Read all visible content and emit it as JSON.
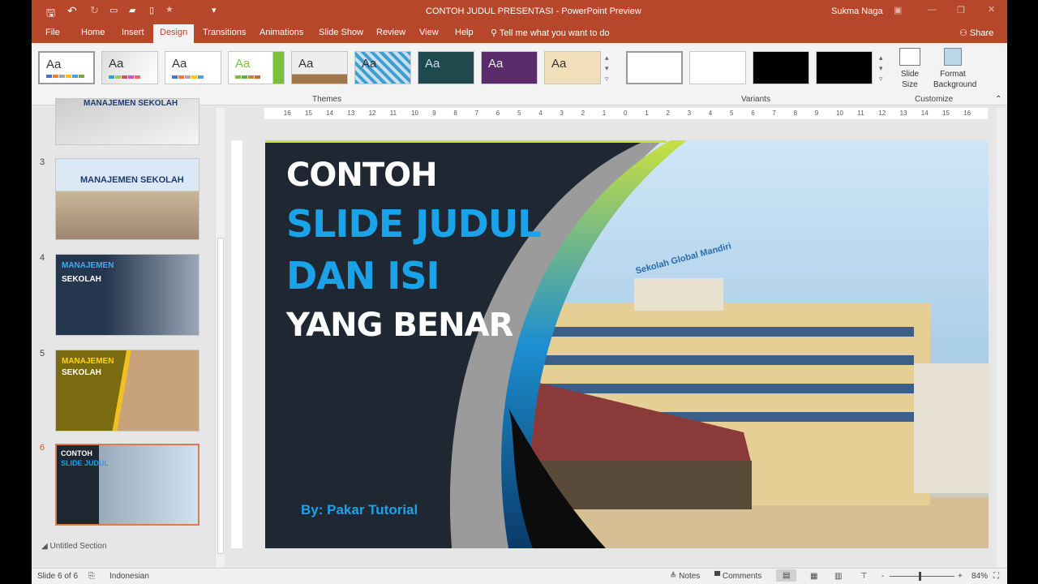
{
  "titlebar": {
    "title": "CONTOH JUDUL PRESENTASI  -  PowerPoint Preview",
    "user": "Sukma Naga"
  },
  "tabs": [
    "File",
    "Home",
    "Insert",
    "Design",
    "Transitions",
    "Animations",
    "Slide Show",
    "Review",
    "View",
    "Help"
  ],
  "active_tab": "Design",
  "tell_me": "Tell me what you want to do",
  "share": "Share",
  "ribbon": {
    "themes_label": "Themes",
    "variants_label": "Variants",
    "customize_label": "Customize",
    "slide_size": "Slide Size",
    "format_background": "Format Background",
    "theme_sample": "Aa"
  },
  "thumbnails": [
    {
      "num": "3",
      "title": "MANAJEMEN SEKOLAH"
    },
    {
      "num": "4",
      "title": "MANAJEMEN",
      "sub": "SEKOLAH"
    },
    {
      "num": "5",
      "title": "MANAJEMEN",
      "sub": "SEKOLAH"
    },
    {
      "num": "6",
      "title": "CONTOH",
      "sub": "SLIDE JUDUL"
    }
  ],
  "section": "Untitled Section",
  "top_thumb_title": "MANAJEMEN SEKOLAH",
  "slide": {
    "line1": "CONTOH",
    "line2": "SLIDE JUDUL",
    "line3": "DAN ISI",
    "line4": "YANG BENAR",
    "byline": "By: Pakar Tutorial",
    "sign": "Sekolah Global Mandiri"
  },
  "status": {
    "slide": "Slide 6 of 6",
    "language": "Indonesian",
    "notes": "Notes",
    "comments": "Comments",
    "zoom": "84%"
  },
  "colors": {
    "accent": "#b7472a",
    "slide_bg": "#1f2732",
    "title_blue": "#1aa3e8"
  }
}
